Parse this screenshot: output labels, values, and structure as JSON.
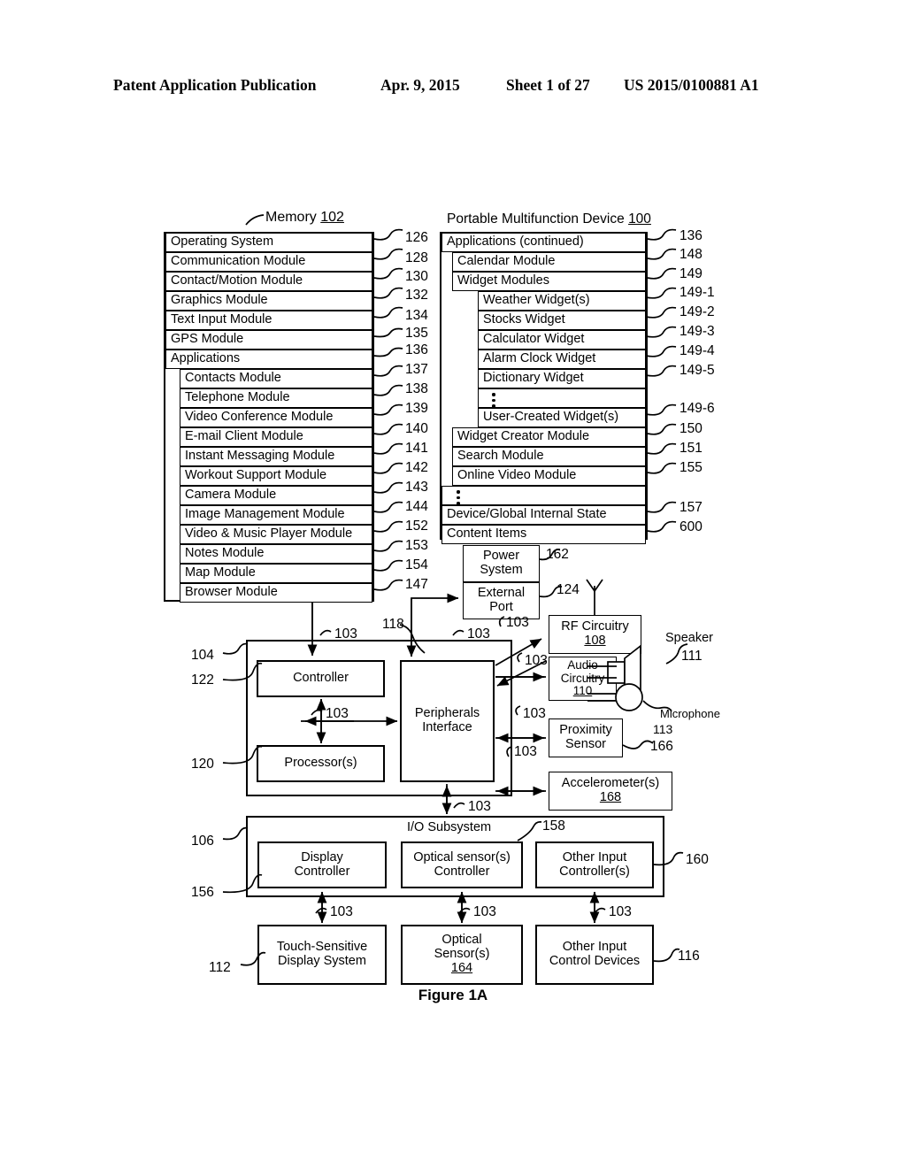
{
  "header": {
    "publication": "Patent Application Publication",
    "date": "Apr. 9, 2015",
    "sheet": "Sheet 1 of 27",
    "number": "US 2015/0100881 A1"
  },
  "figure": {
    "caption": "Figure 1A"
  },
  "memory": {
    "title": "Memory",
    "title_ref": "102",
    "rows": [
      {
        "label": "Operating System",
        "ref": "126"
      },
      {
        "label": "Communication Module",
        "ref": "128"
      },
      {
        "label": "Contact/Motion Module",
        "ref": "130"
      },
      {
        "label": "Graphics Module",
        "ref": "132"
      },
      {
        "label": "Text Input Module",
        "ref": "134"
      },
      {
        "label": "GPS Module",
        "ref": "135"
      },
      {
        "label": "Applications",
        "ref": "136"
      },
      {
        "label": "Contacts Module",
        "ref": "137"
      },
      {
        "label": "Telephone Module",
        "ref": "138"
      },
      {
        "label": "Video Conference Module",
        "ref": "139"
      },
      {
        "label": "E-mail Client Module",
        "ref": "140"
      },
      {
        "label": "Instant Messaging Module",
        "ref": "141"
      },
      {
        "label": "Workout Support Module",
        "ref": "142"
      },
      {
        "label": "Camera Module",
        "ref": "143"
      },
      {
        "label": "Image Management Module",
        "ref": "144"
      },
      {
        "label": "Video & Music Player Module",
        "ref": "152"
      },
      {
        "label": "Notes Module",
        "ref": "153"
      },
      {
        "label": "Map Module",
        "ref": "154"
      },
      {
        "label": "Browser Module",
        "ref": "147"
      }
    ]
  },
  "device": {
    "title": "Portable Multifunction Device",
    "title_ref": "100",
    "rows": [
      {
        "label": "Applications (continued)",
        "ref": "136"
      },
      {
        "label": "Calendar Module",
        "ref": "148"
      },
      {
        "label": "Widget Modules",
        "ref": "149"
      },
      {
        "label": "Weather Widget(s)",
        "ref": "149-1"
      },
      {
        "label": "Stocks Widget",
        "ref": "149-2"
      },
      {
        "label": "Calculator Widget",
        "ref": "149-3"
      },
      {
        "label": "Alarm Clock Widget",
        "ref": "149-4"
      },
      {
        "label": "Dictionary Widget",
        "ref": "149-5"
      },
      {
        "label": "",
        "ref": ""
      },
      {
        "label": "User-Created Widget(s)",
        "ref": "149-6"
      },
      {
        "label": "Widget Creator Module",
        "ref": "150"
      },
      {
        "label": "Search Module",
        "ref": "151"
      },
      {
        "label": "Online Video Module",
        "ref": "155"
      },
      {
        "label": "",
        "ref": ""
      },
      {
        "label": "Device/Global Internal State",
        "ref": "157"
      },
      {
        "label": "Content Items",
        "ref": "600"
      }
    ]
  },
  "blocks": {
    "power_system": {
      "line1": "Power",
      "line2": "System",
      "ref": "162"
    },
    "external_port": {
      "line1": "External",
      "line2": "Port",
      "ref": "124"
    },
    "rf_circuitry": {
      "line1": "RF Circuitry",
      "line2": "108",
      "ref": ""
    },
    "audio_circuitry": {
      "line1": "Audio",
      "line2": "Circuitry",
      "line3": "110",
      "ref": ""
    },
    "proximity_sensor": {
      "line1": "Proximity",
      "line2": "Sensor",
      "ref": "166"
    },
    "accelerometer": {
      "line1": "Accelerometer(s)",
      "line2": "168",
      "ref": ""
    },
    "speaker": {
      "label": "Speaker",
      "ref": "111"
    },
    "microphone": {
      "label": "Microphone",
      "ref": "113"
    },
    "controller": {
      "label": "Controller",
      "ref": "122"
    },
    "processors": {
      "label": "Processor(s)",
      "ref": "120"
    },
    "peripherals": {
      "line1": "Peripherals",
      "line2": "Interface",
      "ref": "118"
    },
    "cpu_group_ref": "104",
    "io_subsystem": {
      "label": "I/O Subsystem",
      "ref": "158",
      "outer_ref": "106"
    },
    "display_controller": {
      "line1": "Display",
      "line2": "Controller",
      "ref": "156"
    },
    "optical_sensor_controller": {
      "line1": "Optical sensor(s)",
      "line2": "Controller",
      "ref": ""
    },
    "other_input_controller": {
      "line1": "Other Input",
      "line2": "Controller(s)",
      "ref": "160"
    },
    "touch_display": {
      "line1": "Touch-Sensitive",
      "line2": "Display System",
      "ref": "112"
    },
    "optical_sensor": {
      "line1": "Optical",
      "line2": "Sensor(s)",
      "line3": "164",
      "ref": ""
    },
    "other_input_devices": {
      "line1": "Other Input",
      "line2": "Control Devices",
      "ref": "116"
    }
  },
  "bus_label": "103"
}
